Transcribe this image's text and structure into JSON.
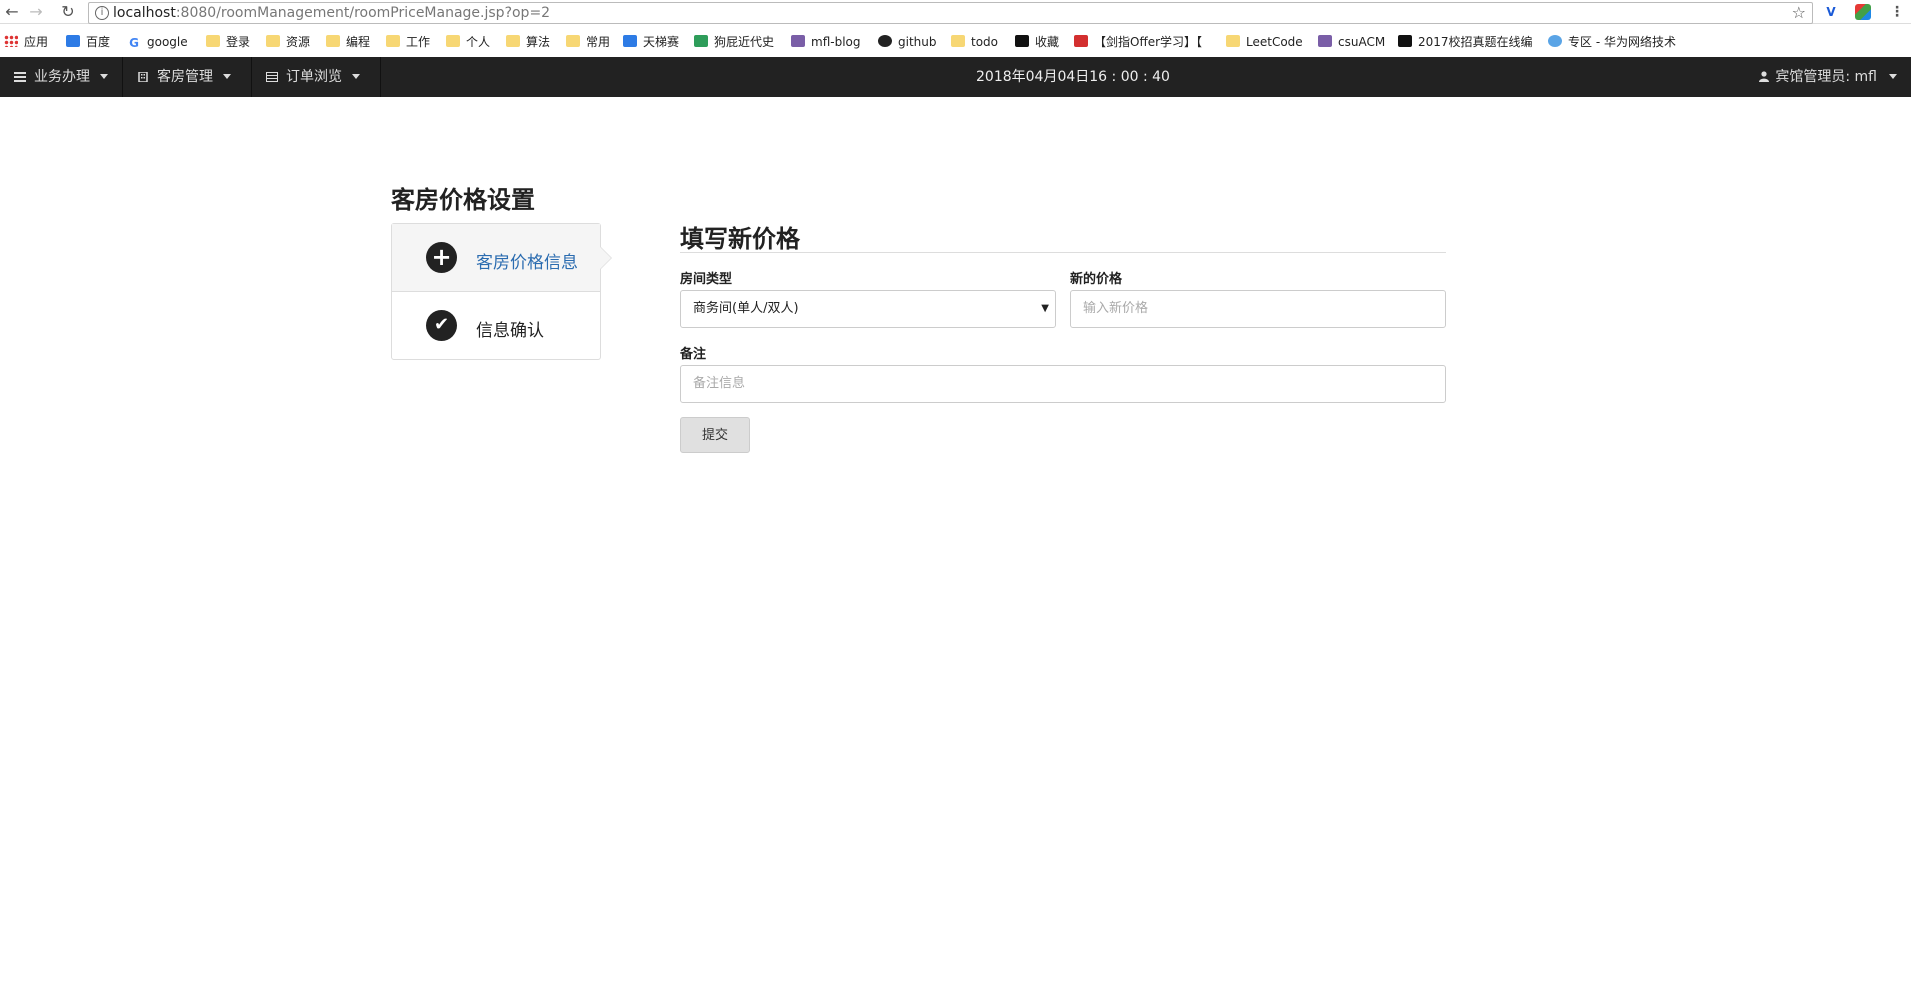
{
  "browser": {
    "url_host": "localhost",
    "url_path": ":8080/roomManagement/roomPriceManage.jsp?op=2",
    "bookmarks": [
      {
        "label": "应用",
        "icon": "apps-grid-icon"
      },
      {
        "label": "百度",
        "icon": "baidu-icon"
      },
      {
        "label": "google",
        "icon": "google-icon"
      },
      {
        "label": "登录",
        "icon": "folder-icon"
      },
      {
        "label": "资源",
        "icon": "folder-icon"
      },
      {
        "label": "编程",
        "icon": "folder-icon"
      },
      {
        "label": "工作",
        "icon": "folder-icon"
      },
      {
        "label": "个人",
        "icon": "folder-icon"
      },
      {
        "label": "算法",
        "icon": "folder-icon"
      },
      {
        "label": "常用",
        "icon": "folder-icon"
      },
      {
        "label": "天梯赛",
        "icon": "pat-icon"
      },
      {
        "label": "狗屁近代史",
        "icon": "map-icon"
      },
      {
        "label": "mfl-blog",
        "icon": "blog-icon"
      },
      {
        "label": "github",
        "icon": "github-icon"
      },
      {
        "label": "todo",
        "icon": "folder-icon"
      },
      {
        "label": "收藏",
        "icon": "book-icon"
      },
      {
        "label": "【剑指Offer学习】【",
        "icon": "c-icon"
      },
      {
        "label": "LeetCode",
        "icon": "leetcode-icon"
      },
      {
        "label": "csuACM",
        "icon": "csu-icon"
      },
      {
        "label": "2017校招真题在线编",
        "icon": "nowcoder-icon"
      },
      {
        "label": "专区 - 华为网络技术",
        "icon": "cloud-icon"
      }
    ]
  },
  "navbar": {
    "menus": [
      {
        "label": "业务办理"
      },
      {
        "label": "客房管理"
      },
      {
        "label": "订单浏览"
      }
    ],
    "clock": "2018年04月04日16 : 00 : 40",
    "user": "宾馆管理员: mfl"
  },
  "page": {
    "title": "客房价格设置",
    "steps": [
      {
        "label": "客房价格信息",
        "icon": "plus-circle-icon",
        "active": true
      },
      {
        "label": "信息确认",
        "icon": "check-circle-icon",
        "active": false
      }
    ]
  },
  "form": {
    "title": "填写新价格",
    "room_type_label": "房间类型",
    "room_type_value": "商务间(单人/双人)",
    "price_label": "新的价格",
    "price_placeholder": "输入新价格",
    "note_label": "备注",
    "note_placeholder": "备注信息",
    "submit_label": "提交"
  }
}
